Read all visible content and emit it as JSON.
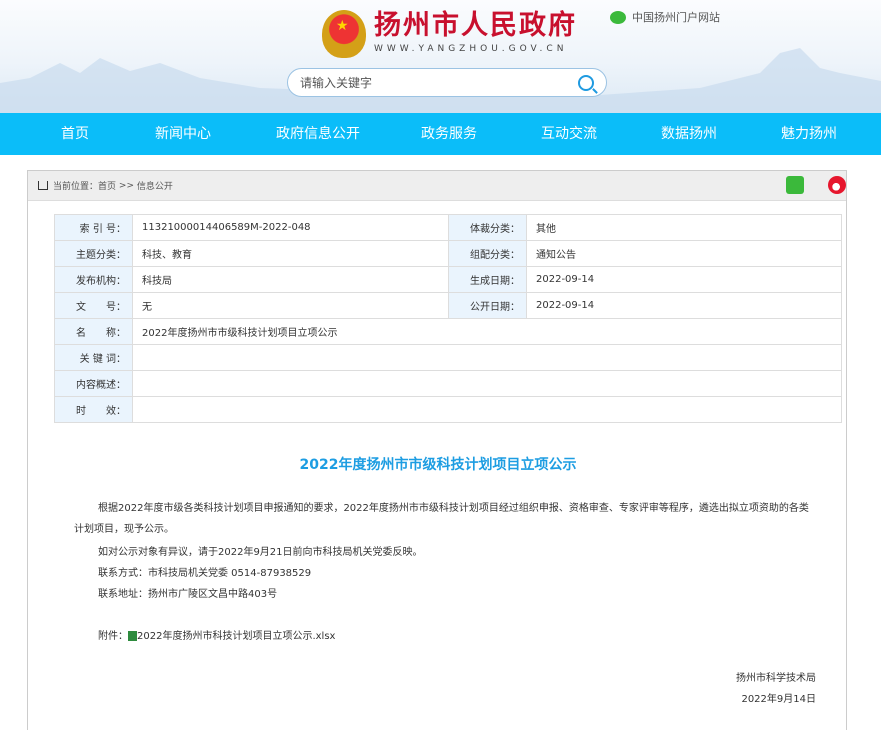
{
  "header": {
    "site_title": "扬州市人民政府",
    "site_url": "WWW.YANGZHOU.GOV.CN",
    "portal_link": "中国扬州门户网站",
    "search_placeholder": "请输入关键字"
  },
  "nav": [
    "首页",
    "新闻中心",
    "政府信息公开",
    "政务服务",
    "互动交流",
    "数据扬州",
    "魅力扬州"
  ],
  "breadcrumb": {
    "prefix": "当前位置：",
    "home": "首页",
    "sep": ">>",
    "current": "信息公开"
  },
  "meta": [
    {
      "l1": "索 引 号：",
      "v1": "11321000014406589M-2022-048",
      "l2": "体裁分类：",
      "v2": "其他"
    },
    {
      "l1": "主题分类：",
      "v1": "科技、教育",
      "l2": "组配分类：",
      "v2": "通知公告"
    },
    {
      "l1": "发布机构：",
      "v1": "科技局",
      "l2": "生成日期：",
      "v2": "2022-09-14"
    },
    {
      "l1": "文　　号：",
      "v1": "无",
      "l2": "公开日期：",
      "v2": "2022-09-14"
    }
  ],
  "meta_full": [
    {
      "l": "名　　称：",
      "v": "2022年度扬州市市级科技计划项目立项公示"
    },
    {
      "l": "关 键 词：",
      "v": ""
    },
    {
      "l": "内容概述：",
      "v": ""
    },
    {
      "l": "时　　效：",
      "v": ""
    }
  ],
  "article": {
    "title": "2022年度扬州市市级科技计划项目立项公示",
    "paragraphs": [
      "根据2022年度市级各类科技计划项目申报通知的要求，2022年度扬州市市级科技计划项目经过组织申报、资格审查、专家评审等程序，遴选出拟立项资助的各类计划项目，现予公示。",
      "如对公示对象有异议，请于2022年9月21日前向市科技局机关党委反映。",
      "联系方式：市科技局机关党委 0514-87938529",
      "联系地址：扬州市广陵区文昌中路403号"
    ],
    "attachment_label": "附件：",
    "attachment_file": "2022年度扬州市科技计划项目立项公示.xlsx",
    "signer": "扬州市科学技术局",
    "date": "2022年9月14日"
  }
}
